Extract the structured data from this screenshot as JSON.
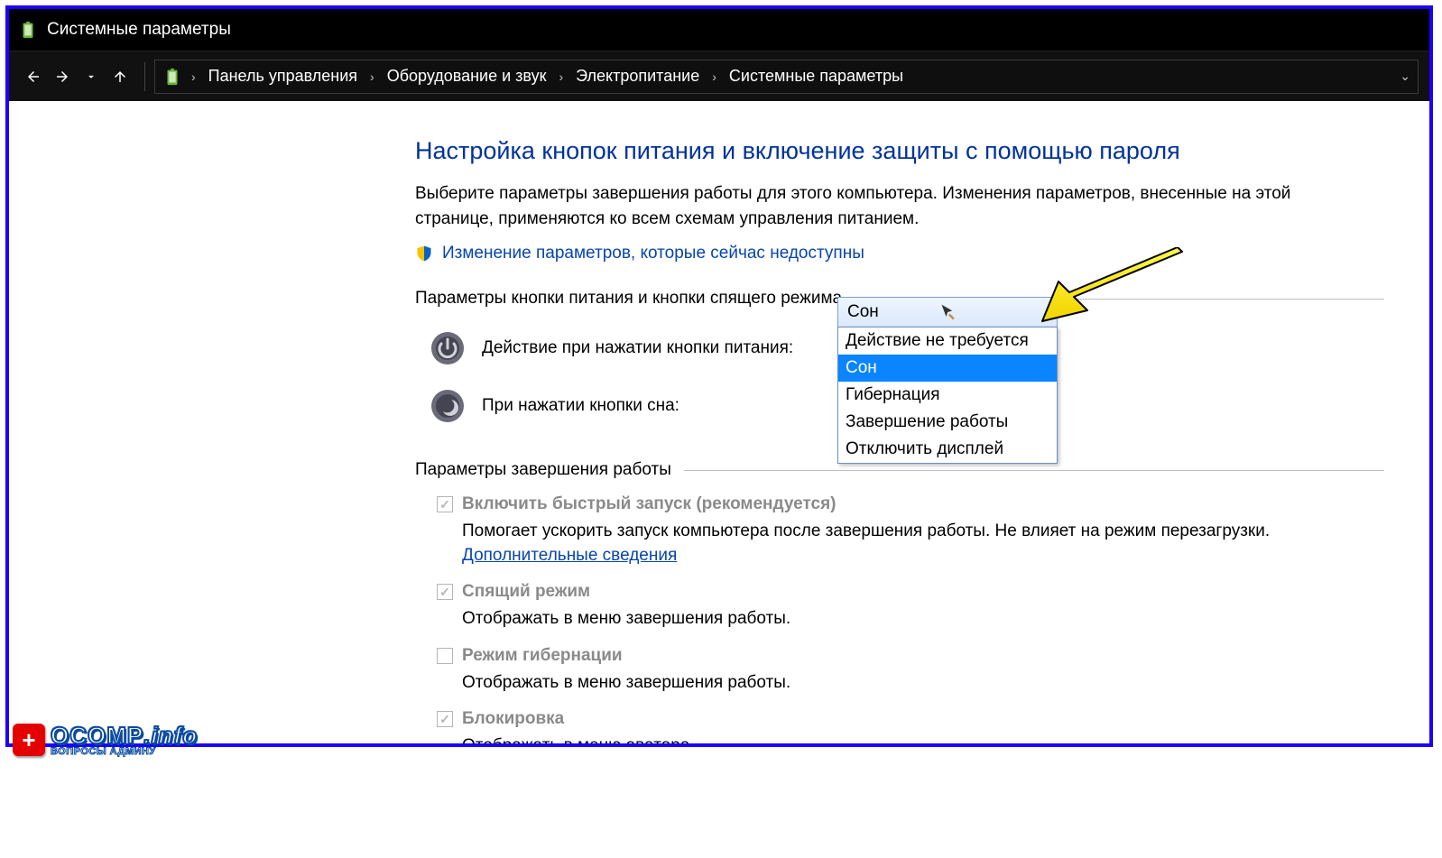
{
  "window": {
    "title": "Системные параметры"
  },
  "breadcrumbs": {
    "items": [
      "Панель управления",
      "Оборудование и звук",
      "Электропитание",
      "Системные параметры"
    ]
  },
  "main": {
    "heading": "Настройка кнопок питания и включение защиты с помощью пароля",
    "description": "Выберите параметры завершения работы для этого компьютера. Изменения параметров, внесенные на этой странице, применяются ко всем схемам управления питанием.",
    "unlock_link": "Изменение параметров, которые сейчас недоступны"
  },
  "section_buttons": {
    "title": "Параметры кнопки питания и кнопки спящего режима",
    "power_label": "Действие при нажатии кнопки питания:",
    "sleep_label": "При нажатии кнопки сна:",
    "power_selected": "Сон",
    "dropdown_options": [
      "Действие не требуется",
      "Сон",
      "Гибернация",
      "Завершение работы",
      "Отключить дисплей"
    ],
    "dropdown_selected_index": 1
  },
  "section_shutdown": {
    "title": "Параметры завершения работы",
    "fast_startup": {
      "label": "Включить быстрый запуск (рекомендуется)",
      "checked": true,
      "desc_prefix": "Помогает ускорить запуск компьютера после завершения работы. Не влияет на режим перезагрузки. ",
      "link": "Дополнительные сведения"
    },
    "sleep_mode": {
      "label": "Спящий режим",
      "checked": true,
      "desc": "Отображать в меню завершения работы."
    },
    "hibernate": {
      "label": "Режим гибернации",
      "checked": false,
      "desc": "Отображать в меню завершения работы."
    },
    "lock": {
      "label": "Блокировка",
      "checked": true,
      "desc": "Отображать в меню аватара."
    }
  },
  "watermark": {
    "main": "OCOMP",
    "suffix": ".info",
    "sub": "ВОПРОСЫ АДМИНУ"
  }
}
